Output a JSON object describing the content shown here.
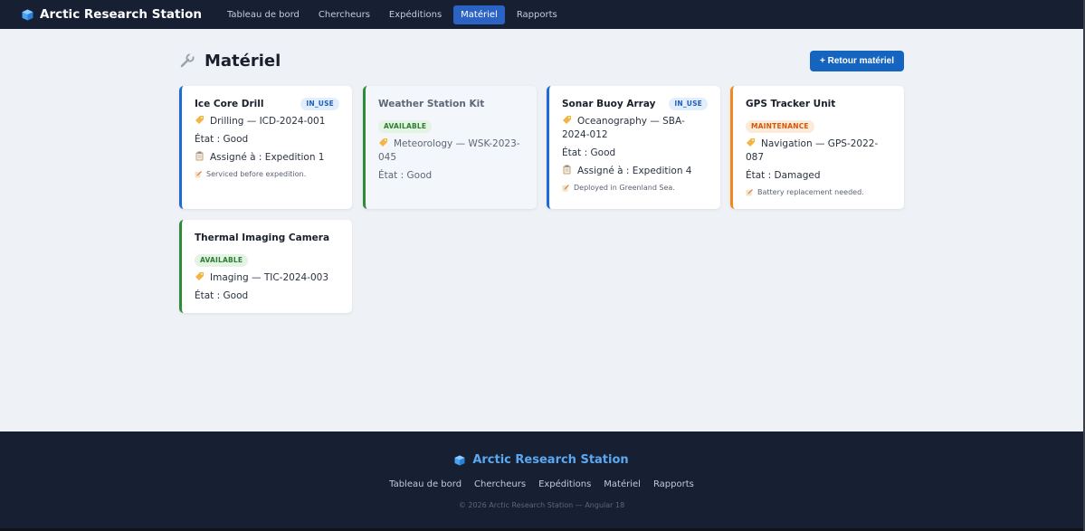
{
  "app": {
    "brand": "Arctic Research Station",
    "nav": [
      "Tableau de bord",
      "Chercheurs",
      "Expéditions",
      "Matériel",
      "Rapports"
    ],
    "active_nav": "Matériel"
  },
  "page": {
    "title": "Matériel",
    "return_button": "+ Retour matériel"
  },
  "equipment": [
    {
      "name": "Ice Core Drill",
      "status": "IN_USE",
      "category_line": "Drilling — ICD-2024-001",
      "state": "État : Good",
      "assigned": "Assigné à : Expedition 1",
      "note": "Serviced before expedition."
    },
    {
      "name": "Weather Station Kit",
      "status": "AVAILABLE",
      "category_line": "Meteorology — WSK-2023-045",
      "state": "État : Good"
    },
    {
      "name": "Sonar Buoy Array",
      "status": "IN_USE",
      "category_line": "Oceanography — SBA-2024-012",
      "state": "État : Good",
      "assigned": "Assigné à : Expedition 4",
      "note": "Deployed in Greenland Sea."
    },
    {
      "name": "GPS Tracker Unit",
      "status": "MAINTENANCE",
      "category_line": "Navigation — GPS-2022-087",
      "state": "État : Damaged",
      "note": "Battery replacement needed."
    },
    {
      "name": "Thermal Imaging Camera",
      "status": "AVAILABLE",
      "category_line": "Imaging — TIC-2024-003",
      "state": "État : Good"
    }
  ],
  "footer": {
    "brand": "Arctic Research Station",
    "links": [
      "Tableau de bord",
      "Chercheurs",
      "Expéditions",
      "Matériel",
      "Rapports"
    ],
    "copyright": "© 2026 Arctic Research Station — Angular 18"
  },
  "colors": {
    "nav_bg": "#172033",
    "accent": "#1565c0",
    "in_use": "#1e6ad9",
    "available": "#2e8b3a",
    "maintenance": "#f08a1c"
  }
}
